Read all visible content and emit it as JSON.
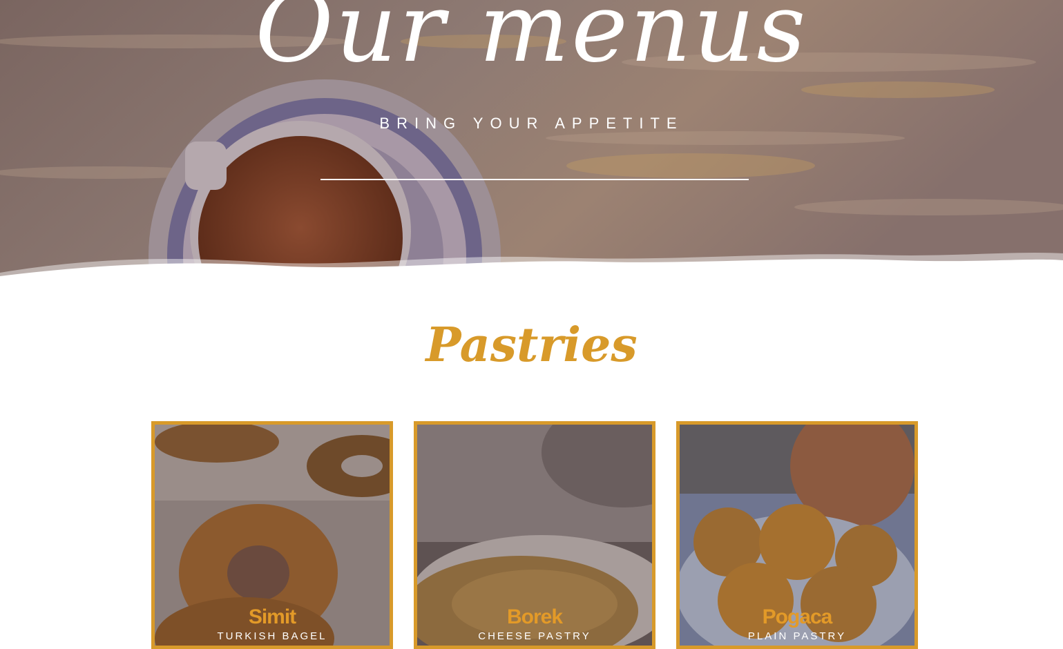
{
  "hero": {
    "title": "Our menus",
    "subtitle": "BRING YOUR APPETITE"
  },
  "section": {
    "title": "Pastries"
  },
  "cards": [
    {
      "name": "Simit",
      "description": "TURKISH BAGEL"
    },
    {
      "name": "Borek",
      "description": "CHEESE PASTRY"
    },
    {
      "name": "Pogaca",
      "description": "PLAIN PASTRY"
    }
  ],
  "colors": {
    "accent": "#d89a2a",
    "overlay": "#5b4b46"
  }
}
